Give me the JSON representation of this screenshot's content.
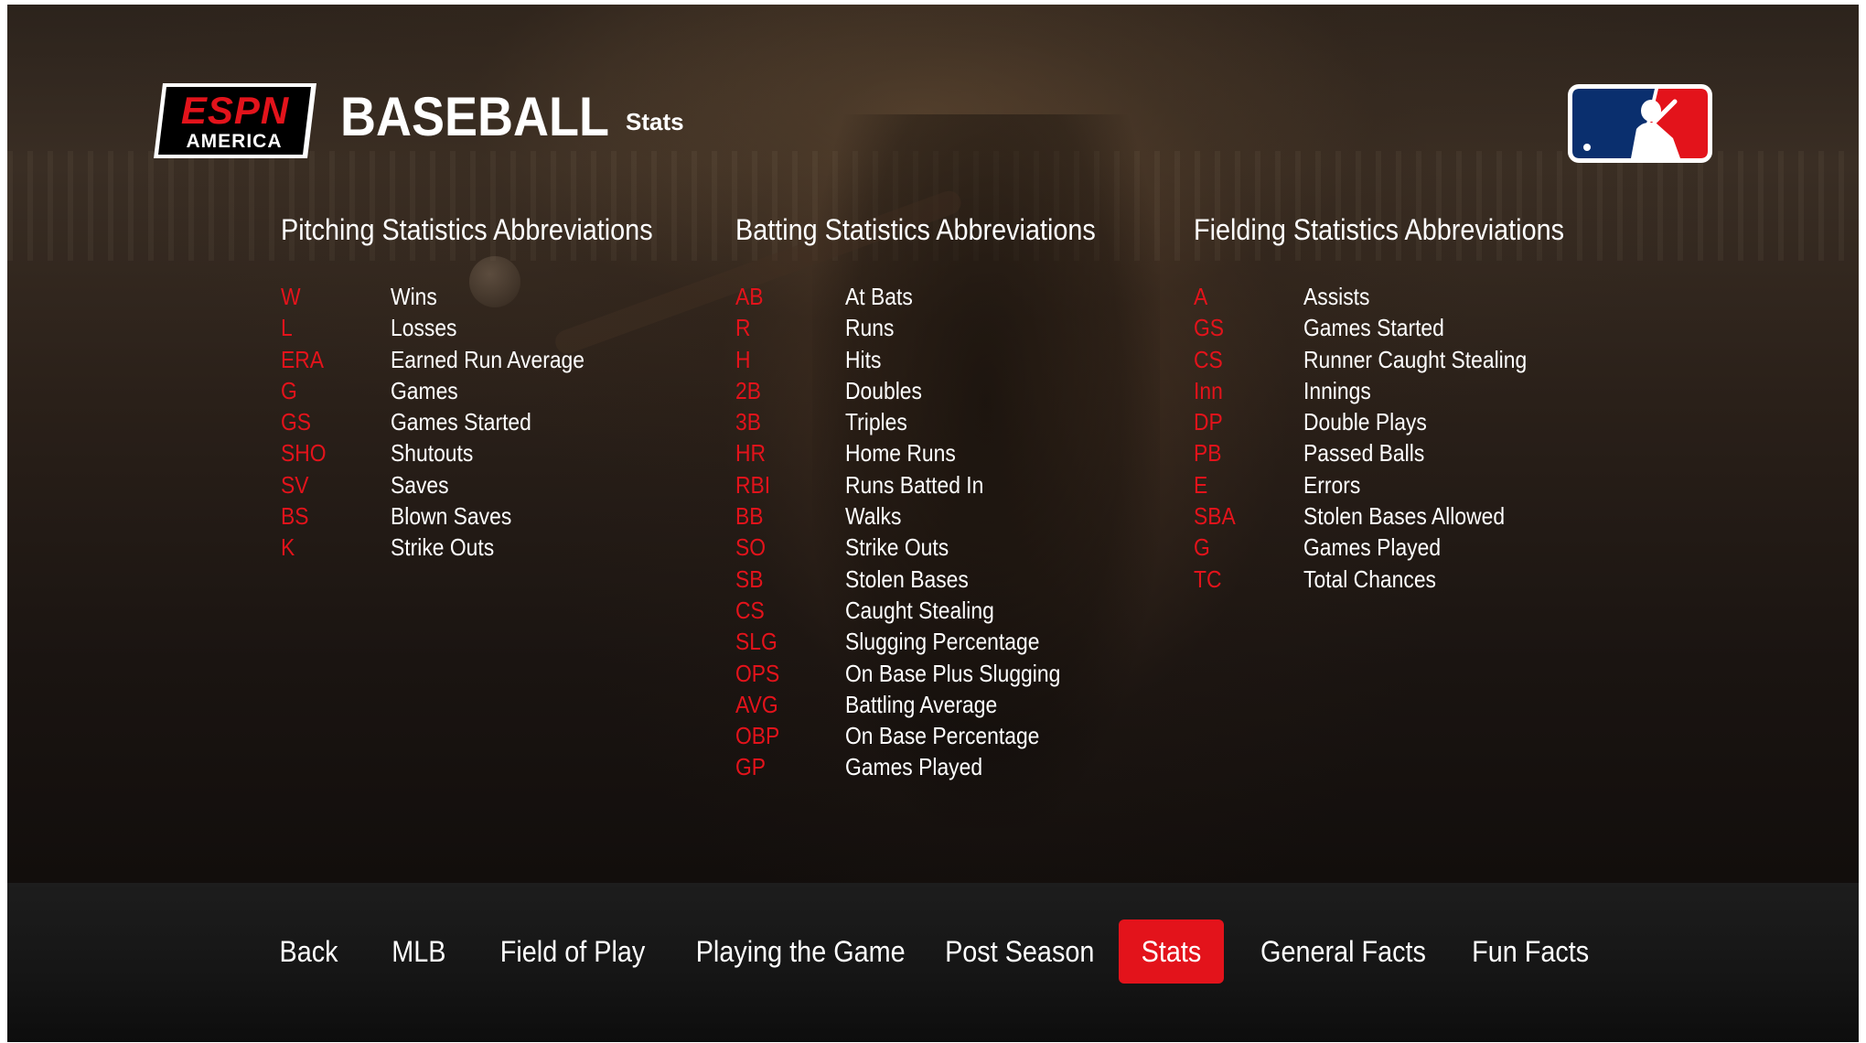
{
  "header": {
    "logo_text_top": "ESPN",
    "logo_text_bottom": "AMERICA",
    "title": "BASEBALL",
    "subtitle": "Stats"
  },
  "pitching": {
    "heading": "Pitching Statistics Abbreviations",
    "items": [
      {
        "abbr": "W",
        "label": "Wins"
      },
      {
        "abbr": "L",
        "label": "Losses"
      },
      {
        "abbr": "ERA",
        "label": "Earned Run Average"
      },
      {
        "abbr": "G",
        "label": "Games"
      },
      {
        "abbr": "GS",
        "label": "Games Started"
      },
      {
        "abbr": "SHO",
        "label": "Shutouts"
      },
      {
        "abbr": "SV",
        "label": "Saves"
      },
      {
        "abbr": "BS",
        "label": "Blown Saves"
      },
      {
        "abbr": "K",
        "label": "Strike Outs"
      }
    ]
  },
  "batting": {
    "heading": "Batting Statistics Abbreviations",
    "items": [
      {
        "abbr": "AB",
        "label": "At Bats"
      },
      {
        "abbr": "R",
        "label": "Runs"
      },
      {
        "abbr": "H",
        "label": "Hits"
      },
      {
        "abbr": "2B",
        "label": "Doubles"
      },
      {
        "abbr": "3B",
        "label": "Triples"
      },
      {
        "abbr": "HR",
        "label": "Home Runs"
      },
      {
        "abbr": "RBI",
        "label": "Runs Batted In"
      },
      {
        "abbr": "BB",
        "label": "Walks"
      },
      {
        "abbr": "SO",
        "label": "Strike Outs"
      },
      {
        "abbr": "SB",
        "label": "Stolen Bases"
      },
      {
        "abbr": "CS",
        "label": "Caught Stealing"
      },
      {
        "abbr": "SLG",
        "label": "Slugging Percentage"
      },
      {
        "abbr": "OPS",
        "label": "On Base Plus Slugging"
      },
      {
        "abbr": "AVG",
        "label": "Battling Average"
      },
      {
        "abbr": "OBP",
        "label": "On Base Percentage"
      },
      {
        "abbr": "GP",
        "label": "Games Played"
      }
    ]
  },
  "fielding": {
    "heading": "Fielding Statistics Abbreviations",
    "items": [
      {
        "abbr": "A",
        "label": "Assists"
      },
      {
        "abbr": "GS",
        "label": "Games Started"
      },
      {
        "abbr": "CS",
        "label": "Runner Caught Stealing"
      },
      {
        "abbr": "Inn",
        "label": "Innings"
      },
      {
        "abbr": "DP",
        "label": "Double Plays"
      },
      {
        "abbr": "PB",
        "label": "Passed Balls"
      },
      {
        "abbr": "E",
        "label": "Errors"
      },
      {
        "abbr": "SBA",
        "label": "Stolen Bases Allowed"
      },
      {
        "abbr": "G",
        "label": "Games Played"
      },
      {
        "abbr": "TC",
        "label": "Total Chances"
      }
    ]
  },
  "nav": {
    "items": [
      {
        "label": "Back",
        "active": false
      },
      {
        "label": "MLB",
        "active": false
      },
      {
        "label": "Field of Play",
        "active": false
      },
      {
        "label": "Playing the Game",
        "active": false
      },
      {
        "label": "Post Season",
        "active": false
      },
      {
        "label": "Stats",
        "active": true
      },
      {
        "label": "General Facts",
        "active": false
      },
      {
        "label": "Fun Facts",
        "active": false
      }
    ]
  },
  "colors": {
    "accent_red": "#e3131b",
    "text": "#ffffff",
    "mlb_blue": "#0a2f6e"
  }
}
